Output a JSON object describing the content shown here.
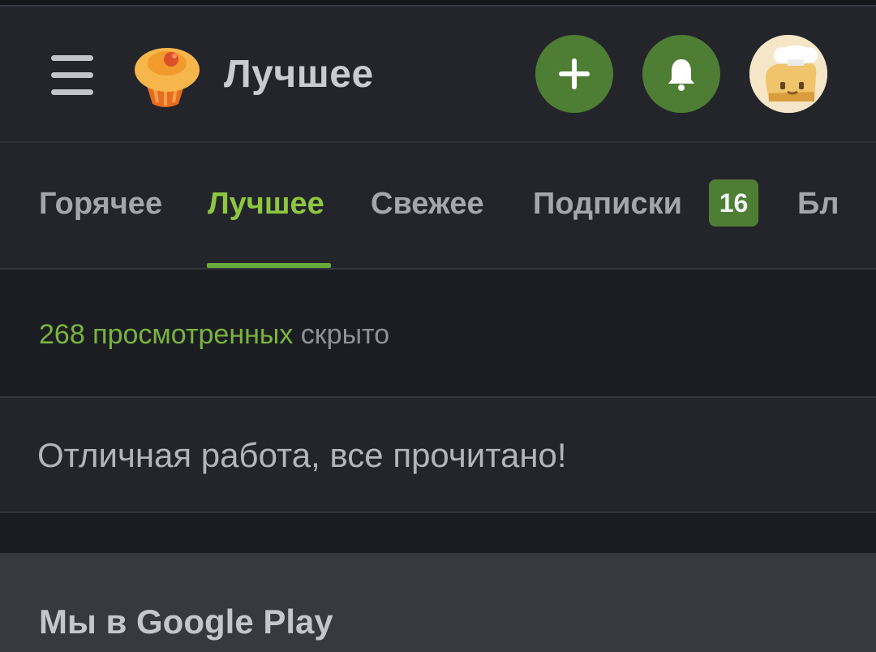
{
  "header": {
    "title": "Лучшее",
    "icons": {
      "menu": "menu-icon",
      "logo": "cupcake-logo-icon",
      "add": "plus-icon",
      "notifications": "bell-icon",
      "avatar": "user-avatar"
    }
  },
  "tabs": [
    {
      "label": "Горячее",
      "active": false
    },
    {
      "label": "Лучшее",
      "active": true
    },
    {
      "label": "Свежее",
      "active": false
    },
    {
      "label": "Подписки",
      "active": false,
      "badge": "16"
    },
    {
      "label": "Бл",
      "active": false
    }
  ],
  "feed": {
    "hidden_count": "268 просмотренных",
    "hidden_suffix": "скрыто",
    "all_read_message": "Отличная работа, все прочитано!",
    "google_play_title": "Мы в Google Play"
  },
  "colors": {
    "accent_green": "#8dc63f",
    "button_green": "#4e7d34",
    "background": "#1c1d22",
    "panel": "#24252b"
  }
}
